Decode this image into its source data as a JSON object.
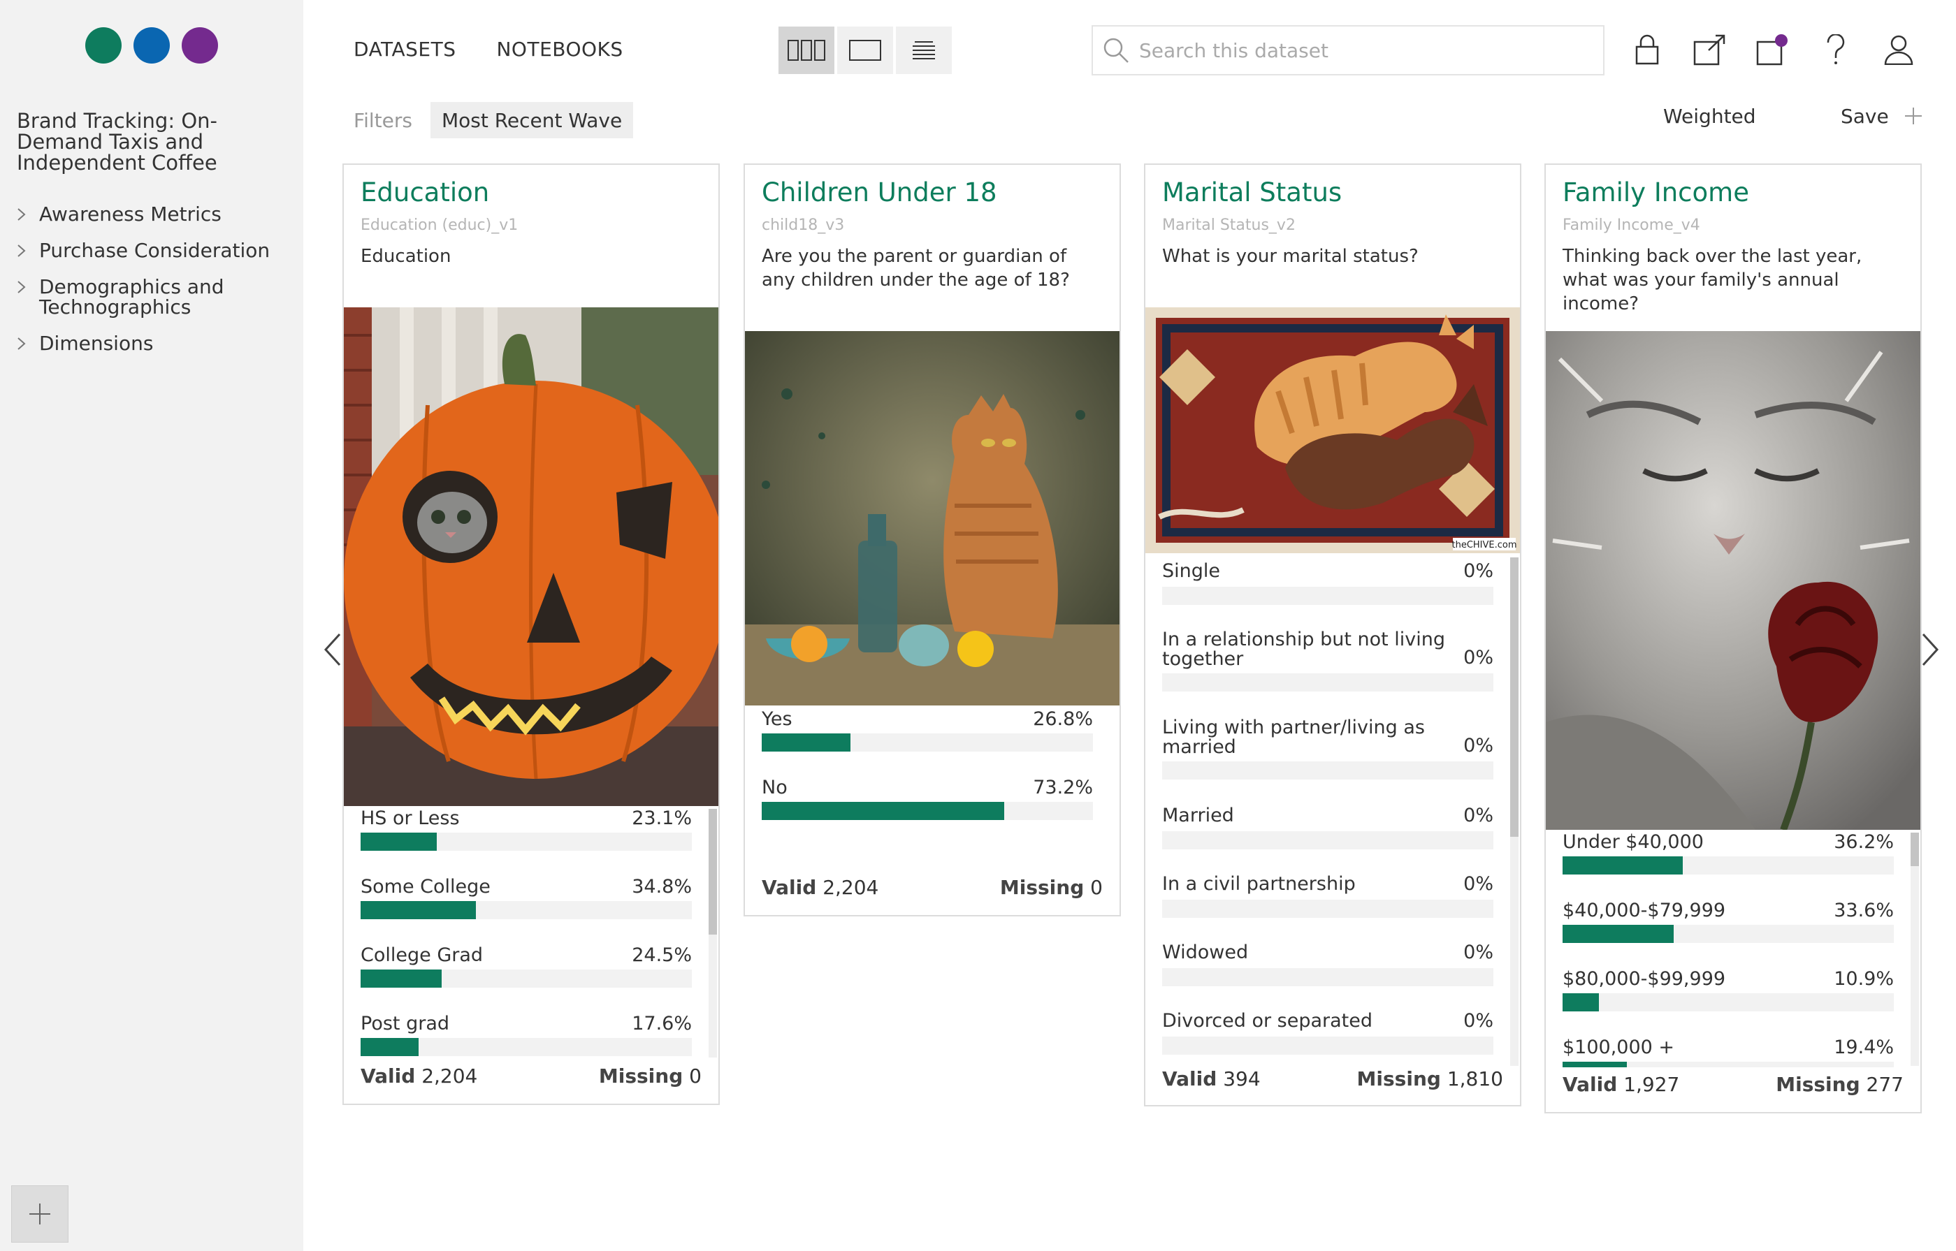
{
  "brand_dots": [
    {
      "color": "#0e7c5e"
    },
    {
      "color": "#0a66b1"
    },
    {
      "color": "#742a8e"
    }
  ],
  "dataset": {
    "title": "Brand Tracking: On-Demand Taxis and Independent Coffee"
  },
  "sidebar": {
    "items": [
      {
        "label": "Awareness Metrics"
      },
      {
        "label": "Purchase Consideration"
      },
      {
        "label": "Demographics and Technographics"
      },
      {
        "label": "Dimensions"
      }
    ]
  },
  "topnav": {
    "datasets": "DATASETS",
    "notebooks": "NOTEBOOKS"
  },
  "search": {
    "placeholder": "Search this dataset"
  },
  "filters": {
    "label": "Filters",
    "chip": "Most Recent Wave"
  },
  "actions": {
    "weighted": "Weighted",
    "save": "Save"
  },
  "accent_color": "#0e7c5e",
  "cards": [
    {
      "title": "Education",
      "alias": "Education (educ)_v1",
      "question": "Education",
      "image": "cat-in-pumpkin",
      "bars": [
        {
          "label": "HS or Less",
          "pct": "23.1%",
          "value": 23.1
        },
        {
          "label": "Some College",
          "pct": "34.8%",
          "value": 34.8
        },
        {
          "label": "College Grad",
          "pct": "24.5%",
          "value": 24.5
        },
        {
          "label": "Post grad",
          "pct": "17.6%",
          "value": 17.6
        }
      ],
      "valid_label": "Valid",
      "valid": "2,204",
      "missing_label": "Missing",
      "missing": "0"
    },
    {
      "title": "Children Under 18",
      "alias": "child18_v3",
      "question": "Are you the parent or guardian of any children under the age of 18?",
      "image": "cat-still-life",
      "bars": [
        {
          "label": "Yes",
          "pct": "26.8%",
          "value": 26.8
        },
        {
          "label": "No",
          "pct": "73.2%",
          "value": 73.2
        }
      ],
      "valid_label": "Valid",
      "valid": "2,204",
      "missing_label": "Missing",
      "missing": "0"
    },
    {
      "title": "Marital Status",
      "alias": "Marital Status_v2",
      "question": "What is your marital status?",
      "image": "cat-and-dog-on-rug",
      "image_caption": "theCHIVE.com",
      "bars": [
        {
          "label": "Single",
          "pct": "0%",
          "value": 0
        },
        {
          "label": "In a relationship but not living together",
          "pct": "0%",
          "value": 0
        },
        {
          "label": "Living with partner/living as married",
          "pct": "0%",
          "value": 0
        },
        {
          "label": "Married",
          "pct": "0%",
          "value": 0
        },
        {
          "label": "In a civil partnership",
          "pct": "0%",
          "value": 0
        },
        {
          "label": "Widowed",
          "pct": "0%",
          "value": 0
        },
        {
          "label": "Divorced or separated",
          "pct": "0%",
          "value": 0
        }
      ],
      "valid_label": "Valid",
      "valid": "394",
      "missing_label": "Missing",
      "missing": "1,810"
    },
    {
      "title": "Family Income",
      "alias": "Family Income_v4",
      "question": "Thinking back over the last year, what was your family's annual income?",
      "image": "sleeping-cat-with-rose",
      "bars": [
        {
          "label": "Under $40,000",
          "pct": "36.2%",
          "value": 36.2
        },
        {
          "label": "$40,000-$79,999",
          "pct": "33.6%",
          "value": 33.6
        },
        {
          "label": "$80,000-$99,999",
          "pct": "10.9%",
          "value": 10.9
        },
        {
          "label": "$100,000 +",
          "pct": "19.4%",
          "value": 19.4
        }
      ],
      "valid_label": "Valid",
      "valid": "1,927",
      "missing_label": "Missing",
      "missing": "277"
    }
  ]
}
